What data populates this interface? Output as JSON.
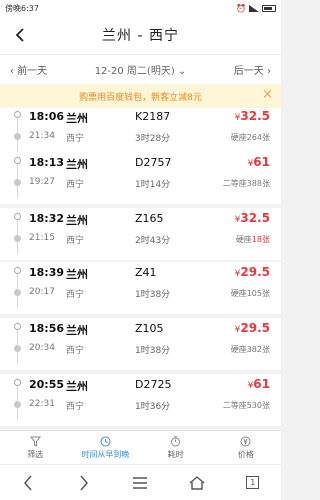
{
  "status": {
    "time": "傍晚6:37"
  },
  "header": {
    "title": "兰州 - 西宁",
    "back_icon": "‹"
  },
  "datebar": {
    "prev_label": "前一天",
    "current": "12-20 周二(明天)",
    "next_label": "后一天"
  },
  "banner": {
    "text": "购票用百度钱包，新客立减8元",
    "close": "×"
  },
  "trains": [
    {
      "dep_time": "18:06",
      "arr_time": "21:34",
      "from": "兰州",
      "to": "西宁",
      "number": "K2187",
      "duration": "3时28分",
      "price": "32.5",
      "seat_label": "硬座",
      "seat_count": "264张",
      "count_red": false
    },
    {
      "dep_time": "18:13",
      "arr_time": "19:27",
      "from": "兰州",
      "to": "西宁",
      "number": "D2757",
      "duration": "1时14分",
      "price": "61",
      "seat_label": "二等座",
      "seat_count": "388张",
      "count_red": false
    },
    {
      "dep_time": "18:32",
      "arr_time": "21:15",
      "from": "兰州",
      "to": "西宁",
      "number": "Z165",
      "duration": "2时43分",
      "price": "32.5",
      "seat_label": "硬座",
      "seat_count": "18张",
      "count_red": true
    },
    {
      "dep_time": "18:39",
      "arr_time": "20:17",
      "from": "兰州",
      "to": "西宁",
      "number": "Z41",
      "duration": "1时38分",
      "price": "29.5",
      "seat_label": "硬座",
      "seat_count": "105张",
      "count_red": false
    },
    {
      "dep_time": "18:56",
      "arr_time": "20:34",
      "from": "兰州",
      "to": "西宁",
      "number": "Z105",
      "duration": "1时38分",
      "price": "29.5",
      "seat_label": "硬座",
      "seat_count": "382张",
      "count_red": false
    },
    {
      "dep_time": "20:55",
      "arr_time": "22:31",
      "from": "兰州",
      "to": "西宁",
      "number": "D2725",
      "duration": "1时36分",
      "price": "61",
      "seat_label": "二等座",
      "seat_count": "530张",
      "count_red": false
    }
  ],
  "currency": "¥",
  "tabs": [
    {
      "label": "筛选",
      "icon": "filter-icon",
      "active": false
    },
    {
      "label": "时间从早到晚",
      "icon": "clock-icon",
      "active": true
    },
    {
      "label": "耗时",
      "icon": "timer-icon",
      "active": false
    },
    {
      "label": "价格",
      "icon": "price-icon",
      "active": false
    }
  ],
  "navbar": {
    "tab_count": "1"
  }
}
